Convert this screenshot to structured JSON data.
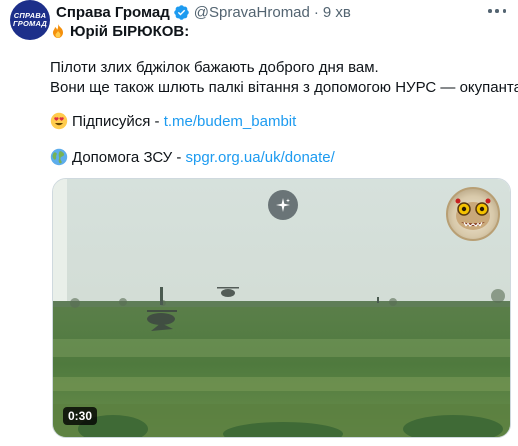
{
  "tweet": {
    "avatar_text": [
      "СПРАВА",
      "ГРОМАД"
    ],
    "author_name": "Справа Громад",
    "handle": "@SpravaHromad",
    "separator": "·",
    "time": "9 хв",
    "headline": "Юрій БІРЮКОВ:",
    "body_line1": "Пілоти злих бджілок бажають доброго дня вам.",
    "body_line2": "Вони ще також шлють палкі вітання з допомогою НУРС — окупантам.",
    "subscribe_text": "Підписуйся -",
    "subscribe_link": "t.me/budem_bambit",
    "donate_text": "Допомога ЗСУ -",
    "donate_link": "spgr.org.ua/uk/donate/"
  },
  "media": {
    "duration": "0:30"
  },
  "icons": {
    "verified": "verified-check-icon",
    "more": "more-options-icon",
    "fire": "fire-emoji-icon",
    "heart_eyes": "heart-eyes-emoji-icon",
    "globe": "globe-emoji-icon",
    "sparkle": "sparkle-icon"
  },
  "colors": {
    "link": "#1d9bf0",
    "verified": "#1d9bf0",
    "avatar_bg": "#1d2f8a",
    "secondary_text": "#536471"
  }
}
